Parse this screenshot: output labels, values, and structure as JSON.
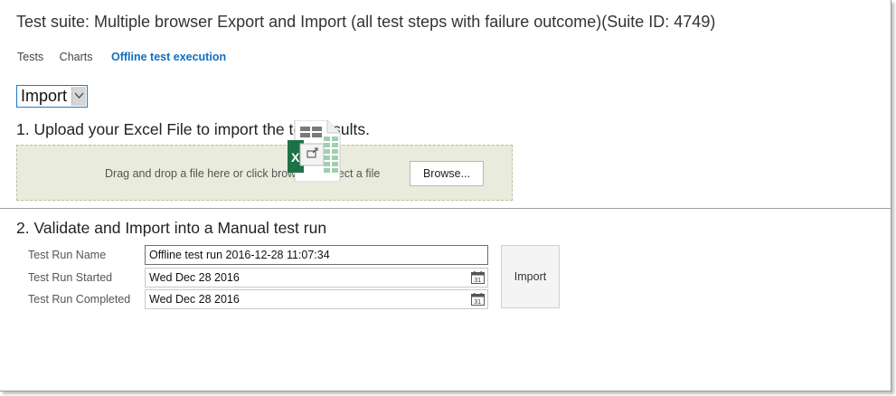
{
  "header": {
    "title": "Test suite: Multiple browser Export and Import (all test steps with failure outcome)(Suite ID: 4749)"
  },
  "tabs": [
    {
      "label": "Tests"
    },
    {
      "label": "Charts"
    },
    {
      "label": "Offline test execution"
    }
  ],
  "mode_select": {
    "value": "Import"
  },
  "upload": {
    "heading": "1. Upload your Excel File to import the test results.",
    "dropzone_text": "Drag and drop a file here or click browse to select a file",
    "browse_label": "Browse..."
  },
  "validate": {
    "heading": "2. Validate and Import into a Manual test run",
    "run_name_label": "Test Run Name",
    "run_name_value": "Offline test run 2016-12-28 11:07:34",
    "started_label": "Test Run Started",
    "started_value": "Wed Dec 28 2016",
    "completed_label": "Test Run Completed",
    "completed_value": "Wed Dec 28 2016",
    "import_label": "Import"
  },
  "icons": {
    "calendar": "calendar-icon",
    "excel": "excel-file-icon",
    "chevron": "chevron-down-icon"
  },
  "colors": {
    "accent": "#106ebe",
    "dropzone": "#e9ecdc",
    "excel_green": "#1e7145"
  }
}
